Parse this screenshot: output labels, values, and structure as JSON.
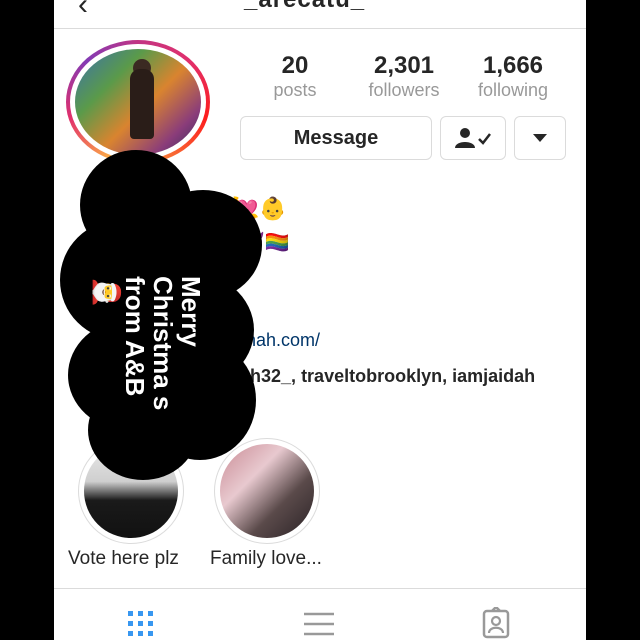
{
  "header": {
    "username": "_arecatu_",
    "back_icon": "arrow-left-icon"
  },
  "profile": {
    "stats": [
      {
        "value": "20",
        "label": "posts"
      },
      {
        "value": "2,301",
        "label": "followers"
      },
      {
        "value": "1,666",
        "label": "following"
      }
    ],
    "message_label": "Message",
    "following_icon": "person-check-icon",
    "more_icon": "caret-down-icon"
  },
  "bio": {
    "line1": "💘👶",
    "line2": "😈🏳️‍🌈",
    "link": "rahah.com/",
    "tags_prefix": "sh32_",
    "tags_rest": "traveltobrooklyn",
    "tags_last": "iamjaidah"
  },
  "sticker": {
    "text": "Merry Christma s from A&B 🎅"
  },
  "highlights": [
    {
      "label": "Vote here plz"
    },
    {
      "label": "Family love..."
    }
  ],
  "tabs": {
    "grid_icon": "grid-icon",
    "list_icon": "list-icon",
    "tagged_icon": "tagged-person-icon"
  },
  "colors": {
    "accent_link": "#003569",
    "border": "#dbdbdb",
    "muted": "#999999"
  }
}
